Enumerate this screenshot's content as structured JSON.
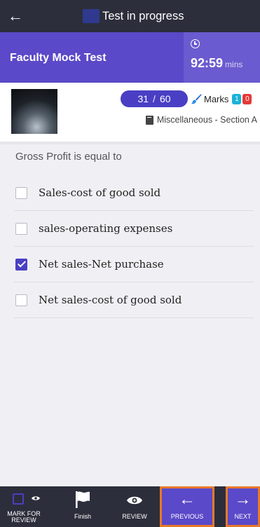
{
  "topbar": {
    "back_icon": "←",
    "title": "Test in progress"
  },
  "header": {
    "test_name": "Faculty Mock Test",
    "timer_value": "92:59",
    "timer_unit": "mins"
  },
  "info": {
    "question_current": "31",
    "question_separator": "/",
    "question_total": "60",
    "marks_label": "Marks",
    "marks_positive": "1",
    "marks_negative": "0",
    "section": "Miscellaneous - Section A"
  },
  "question": {
    "text": "Gross Profit is equal to",
    "options": [
      {
        "label": "Sales-cost of good sold",
        "checked": false
      },
      {
        "label": "sales-operating expenses",
        "checked": false
      },
      {
        "label": "Net sales-Net purchase",
        "checked": true
      },
      {
        "label": "Net sales-cost of good sold",
        "checked": false
      }
    ]
  },
  "bottombar": {
    "mark_review_line1": "MARK FOR",
    "mark_review_line2": "REVIEW",
    "finish": "Finish",
    "review": "REVIEW",
    "previous_icon": "←",
    "previous": "PREVIOUS",
    "next_icon": "→",
    "next": "NEXT"
  },
  "colors": {
    "accent": "#5a49c8",
    "dark_bar": "#2c2e3b",
    "highlight": "#e8792b",
    "positive": "#19b3d8",
    "negative": "#e53935"
  }
}
